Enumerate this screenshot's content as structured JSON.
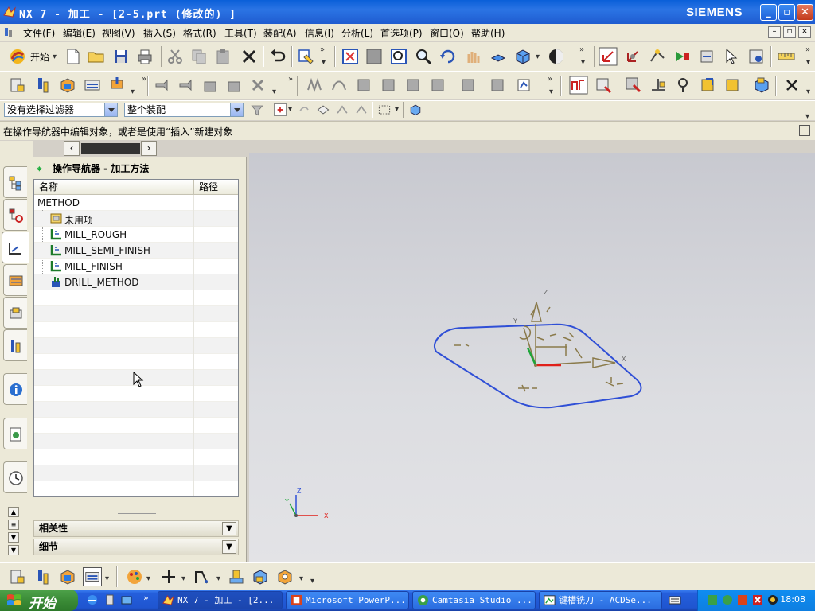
{
  "window": {
    "title": "NX 7 - 加工 - [2-5.prt (修改的) ]",
    "brand": "SIEMENS",
    "minimize_label": "_",
    "maximize_label": "▫",
    "close_label": "✕"
  },
  "menu": {
    "items": [
      "文件(F)",
      "编辑(E)",
      "视图(V)",
      "插入(S)",
      "格式(R)",
      "工具(T)",
      "装配(A)",
      "信息(I)",
      "分析(L)",
      "首选项(P)",
      "窗口(O)",
      "帮助(H)"
    ]
  },
  "toolbar": {
    "start_label": "开始"
  },
  "selection_bar": {
    "filter_value": "没有选择过滤器",
    "scope_value": "整个装配"
  },
  "cue_line": "在操作导航器中编辑对象，或者是使用“插入”新建对象",
  "navigator": {
    "title": "操作导航器 - 加工方法",
    "columns": [
      "名称",
      "路径"
    ],
    "root": "METHOD",
    "items": [
      {
        "label": "未用项"
      },
      {
        "label": "MILL_ROUGH"
      },
      {
        "label": "MILL_SEMI_FINISH"
      },
      {
        "label": "MILL_FINISH"
      },
      {
        "label": "DRILL_METHOD"
      }
    ],
    "sections": [
      "相关性",
      "细节"
    ]
  },
  "viewport": {
    "triad_x": "X",
    "triad_y": "Y",
    "triad_z": "Z",
    "csys_x": "X",
    "csys_y": "Y",
    "csys_z": "Z"
  },
  "taskbar": {
    "start": "开始",
    "tasks": [
      {
        "label": "NX 7 - 加工 - [2...",
        "icon": "nx-icon"
      },
      {
        "label": "Microsoft PowerP...",
        "icon": "powerpoint-icon"
      },
      {
        "label": "Camtasia Studio ...",
        "icon": "camtasia-icon"
      },
      {
        "label": "键槽铣刀 - ACDSe...",
        "icon": "acdsee-icon"
      }
    ],
    "clock": "18:08"
  },
  "colors": {
    "titlebar": "#1f5cd0",
    "taskbar": "#245edb",
    "part_outline": "#2f4fd6",
    "csys_x_axis": "#e0201a",
    "csys_y_axis": "#1ea63a",
    "geometry_olive": "#8a7a4a"
  }
}
